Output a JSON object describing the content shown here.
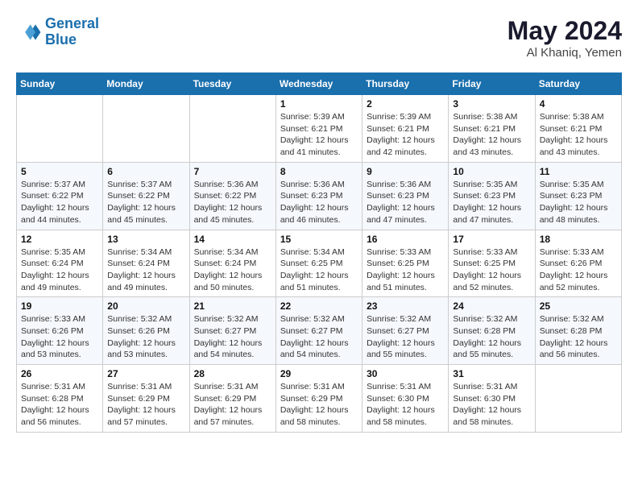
{
  "header": {
    "logo_line1": "General",
    "logo_line2": "Blue",
    "month_year": "May 2024",
    "location": "Al Khaniq, Yemen"
  },
  "weekdays": [
    "Sunday",
    "Monday",
    "Tuesday",
    "Wednesday",
    "Thursday",
    "Friday",
    "Saturday"
  ],
  "weeks": [
    [
      {
        "day": "",
        "info": ""
      },
      {
        "day": "",
        "info": ""
      },
      {
        "day": "",
        "info": ""
      },
      {
        "day": "1",
        "info": "Sunrise: 5:39 AM\nSunset: 6:21 PM\nDaylight: 12 hours\nand 41 minutes."
      },
      {
        "day": "2",
        "info": "Sunrise: 5:39 AM\nSunset: 6:21 PM\nDaylight: 12 hours\nand 42 minutes."
      },
      {
        "day": "3",
        "info": "Sunrise: 5:38 AM\nSunset: 6:21 PM\nDaylight: 12 hours\nand 43 minutes."
      },
      {
        "day": "4",
        "info": "Sunrise: 5:38 AM\nSunset: 6:21 PM\nDaylight: 12 hours\nand 43 minutes."
      }
    ],
    [
      {
        "day": "5",
        "info": "Sunrise: 5:37 AM\nSunset: 6:22 PM\nDaylight: 12 hours\nand 44 minutes."
      },
      {
        "day": "6",
        "info": "Sunrise: 5:37 AM\nSunset: 6:22 PM\nDaylight: 12 hours\nand 45 minutes."
      },
      {
        "day": "7",
        "info": "Sunrise: 5:36 AM\nSunset: 6:22 PM\nDaylight: 12 hours\nand 45 minutes."
      },
      {
        "day": "8",
        "info": "Sunrise: 5:36 AM\nSunset: 6:23 PM\nDaylight: 12 hours\nand 46 minutes."
      },
      {
        "day": "9",
        "info": "Sunrise: 5:36 AM\nSunset: 6:23 PM\nDaylight: 12 hours\nand 47 minutes."
      },
      {
        "day": "10",
        "info": "Sunrise: 5:35 AM\nSunset: 6:23 PM\nDaylight: 12 hours\nand 47 minutes."
      },
      {
        "day": "11",
        "info": "Sunrise: 5:35 AM\nSunset: 6:23 PM\nDaylight: 12 hours\nand 48 minutes."
      }
    ],
    [
      {
        "day": "12",
        "info": "Sunrise: 5:35 AM\nSunset: 6:24 PM\nDaylight: 12 hours\nand 49 minutes."
      },
      {
        "day": "13",
        "info": "Sunrise: 5:34 AM\nSunset: 6:24 PM\nDaylight: 12 hours\nand 49 minutes."
      },
      {
        "day": "14",
        "info": "Sunrise: 5:34 AM\nSunset: 6:24 PM\nDaylight: 12 hours\nand 50 minutes."
      },
      {
        "day": "15",
        "info": "Sunrise: 5:34 AM\nSunset: 6:25 PM\nDaylight: 12 hours\nand 51 minutes."
      },
      {
        "day": "16",
        "info": "Sunrise: 5:33 AM\nSunset: 6:25 PM\nDaylight: 12 hours\nand 51 minutes."
      },
      {
        "day": "17",
        "info": "Sunrise: 5:33 AM\nSunset: 6:25 PM\nDaylight: 12 hours\nand 52 minutes."
      },
      {
        "day": "18",
        "info": "Sunrise: 5:33 AM\nSunset: 6:26 PM\nDaylight: 12 hours\nand 52 minutes."
      }
    ],
    [
      {
        "day": "19",
        "info": "Sunrise: 5:33 AM\nSunset: 6:26 PM\nDaylight: 12 hours\nand 53 minutes."
      },
      {
        "day": "20",
        "info": "Sunrise: 5:32 AM\nSunset: 6:26 PM\nDaylight: 12 hours\nand 53 minutes."
      },
      {
        "day": "21",
        "info": "Sunrise: 5:32 AM\nSunset: 6:27 PM\nDaylight: 12 hours\nand 54 minutes."
      },
      {
        "day": "22",
        "info": "Sunrise: 5:32 AM\nSunset: 6:27 PM\nDaylight: 12 hours\nand 54 minutes."
      },
      {
        "day": "23",
        "info": "Sunrise: 5:32 AM\nSunset: 6:27 PM\nDaylight: 12 hours\nand 55 minutes."
      },
      {
        "day": "24",
        "info": "Sunrise: 5:32 AM\nSunset: 6:28 PM\nDaylight: 12 hours\nand 55 minutes."
      },
      {
        "day": "25",
        "info": "Sunrise: 5:32 AM\nSunset: 6:28 PM\nDaylight: 12 hours\nand 56 minutes."
      }
    ],
    [
      {
        "day": "26",
        "info": "Sunrise: 5:31 AM\nSunset: 6:28 PM\nDaylight: 12 hours\nand 56 minutes."
      },
      {
        "day": "27",
        "info": "Sunrise: 5:31 AM\nSunset: 6:29 PM\nDaylight: 12 hours\nand 57 minutes."
      },
      {
        "day": "28",
        "info": "Sunrise: 5:31 AM\nSunset: 6:29 PM\nDaylight: 12 hours\nand 57 minutes."
      },
      {
        "day": "29",
        "info": "Sunrise: 5:31 AM\nSunset: 6:29 PM\nDaylight: 12 hours\nand 58 minutes."
      },
      {
        "day": "30",
        "info": "Sunrise: 5:31 AM\nSunset: 6:30 PM\nDaylight: 12 hours\nand 58 minutes."
      },
      {
        "day": "31",
        "info": "Sunrise: 5:31 AM\nSunset: 6:30 PM\nDaylight: 12 hours\nand 58 minutes."
      },
      {
        "day": "",
        "info": ""
      }
    ]
  ]
}
